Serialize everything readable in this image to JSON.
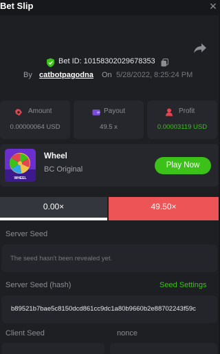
{
  "header": {
    "title": "Bet Slip",
    "close_glyph": "✕"
  },
  "bet": {
    "id_text": "Bet ID: 10158302029678353",
    "by_label": "By",
    "username": "catbotpagodna",
    "on_label": "On",
    "date": "5/28/2022, 8:25:24 PM"
  },
  "stats": [
    {
      "label": "Amount",
      "value": "0.00000064 USD",
      "icon": "coins-icon"
    },
    {
      "label": "Payout",
      "value": "49.5 x",
      "icon": "payout-icon"
    },
    {
      "label": "Profit",
      "value": "0.00003119 USD",
      "icon": "profit-icon"
    }
  ],
  "game": {
    "name": "Wheel",
    "provider": "BC Original",
    "thumb_caption": "WHEEL",
    "play_label": "Play Now"
  },
  "result": {
    "left_label": "0.00×",
    "right_label": "49.50×"
  },
  "seeds": {
    "server_seed_label": "Server Seed",
    "server_seed_value": "The seed hasn't been revealed yet.",
    "server_hash_label": "Server Seed (hash)",
    "seed_settings_label": "Seed Settings",
    "server_hash_value": "b89521b7bae5c8150dcd861cc9dc1a80b9660b2e88702243f59c",
    "client_seed_label": "Client Seed",
    "nonce_label": "nonce"
  },
  "colors": {
    "accent_green": "#3bc117",
    "result_red": "#ed5456",
    "panel": "#26272c",
    "background": "#1e1f23"
  }
}
